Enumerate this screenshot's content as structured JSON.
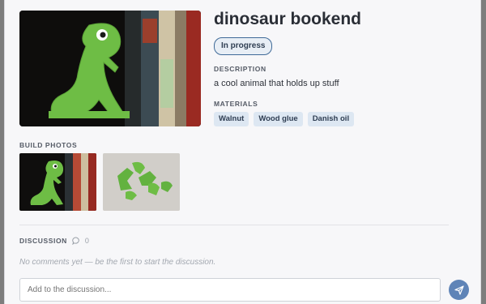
{
  "project": {
    "title": "dinosaur bookend",
    "status": "In progress",
    "description_label": "DESCRIPTION",
    "description": "a cool animal that holds up stuff",
    "materials_label": "MATERIALS",
    "materials": [
      "Walnut",
      "Wood glue",
      "Danish oil"
    ],
    "photos_label": "BUILD PHOTOS"
  },
  "discussion": {
    "label": "DISCUSSION",
    "count": "0",
    "empty_text": "No comments yet — be the first to start the discussion.",
    "input_placeholder": "Add to the discussion..."
  },
  "colors": {
    "accent": "#5f84b7",
    "chip_bg": "#dde7f2",
    "dino_green": "#6ebd45"
  }
}
